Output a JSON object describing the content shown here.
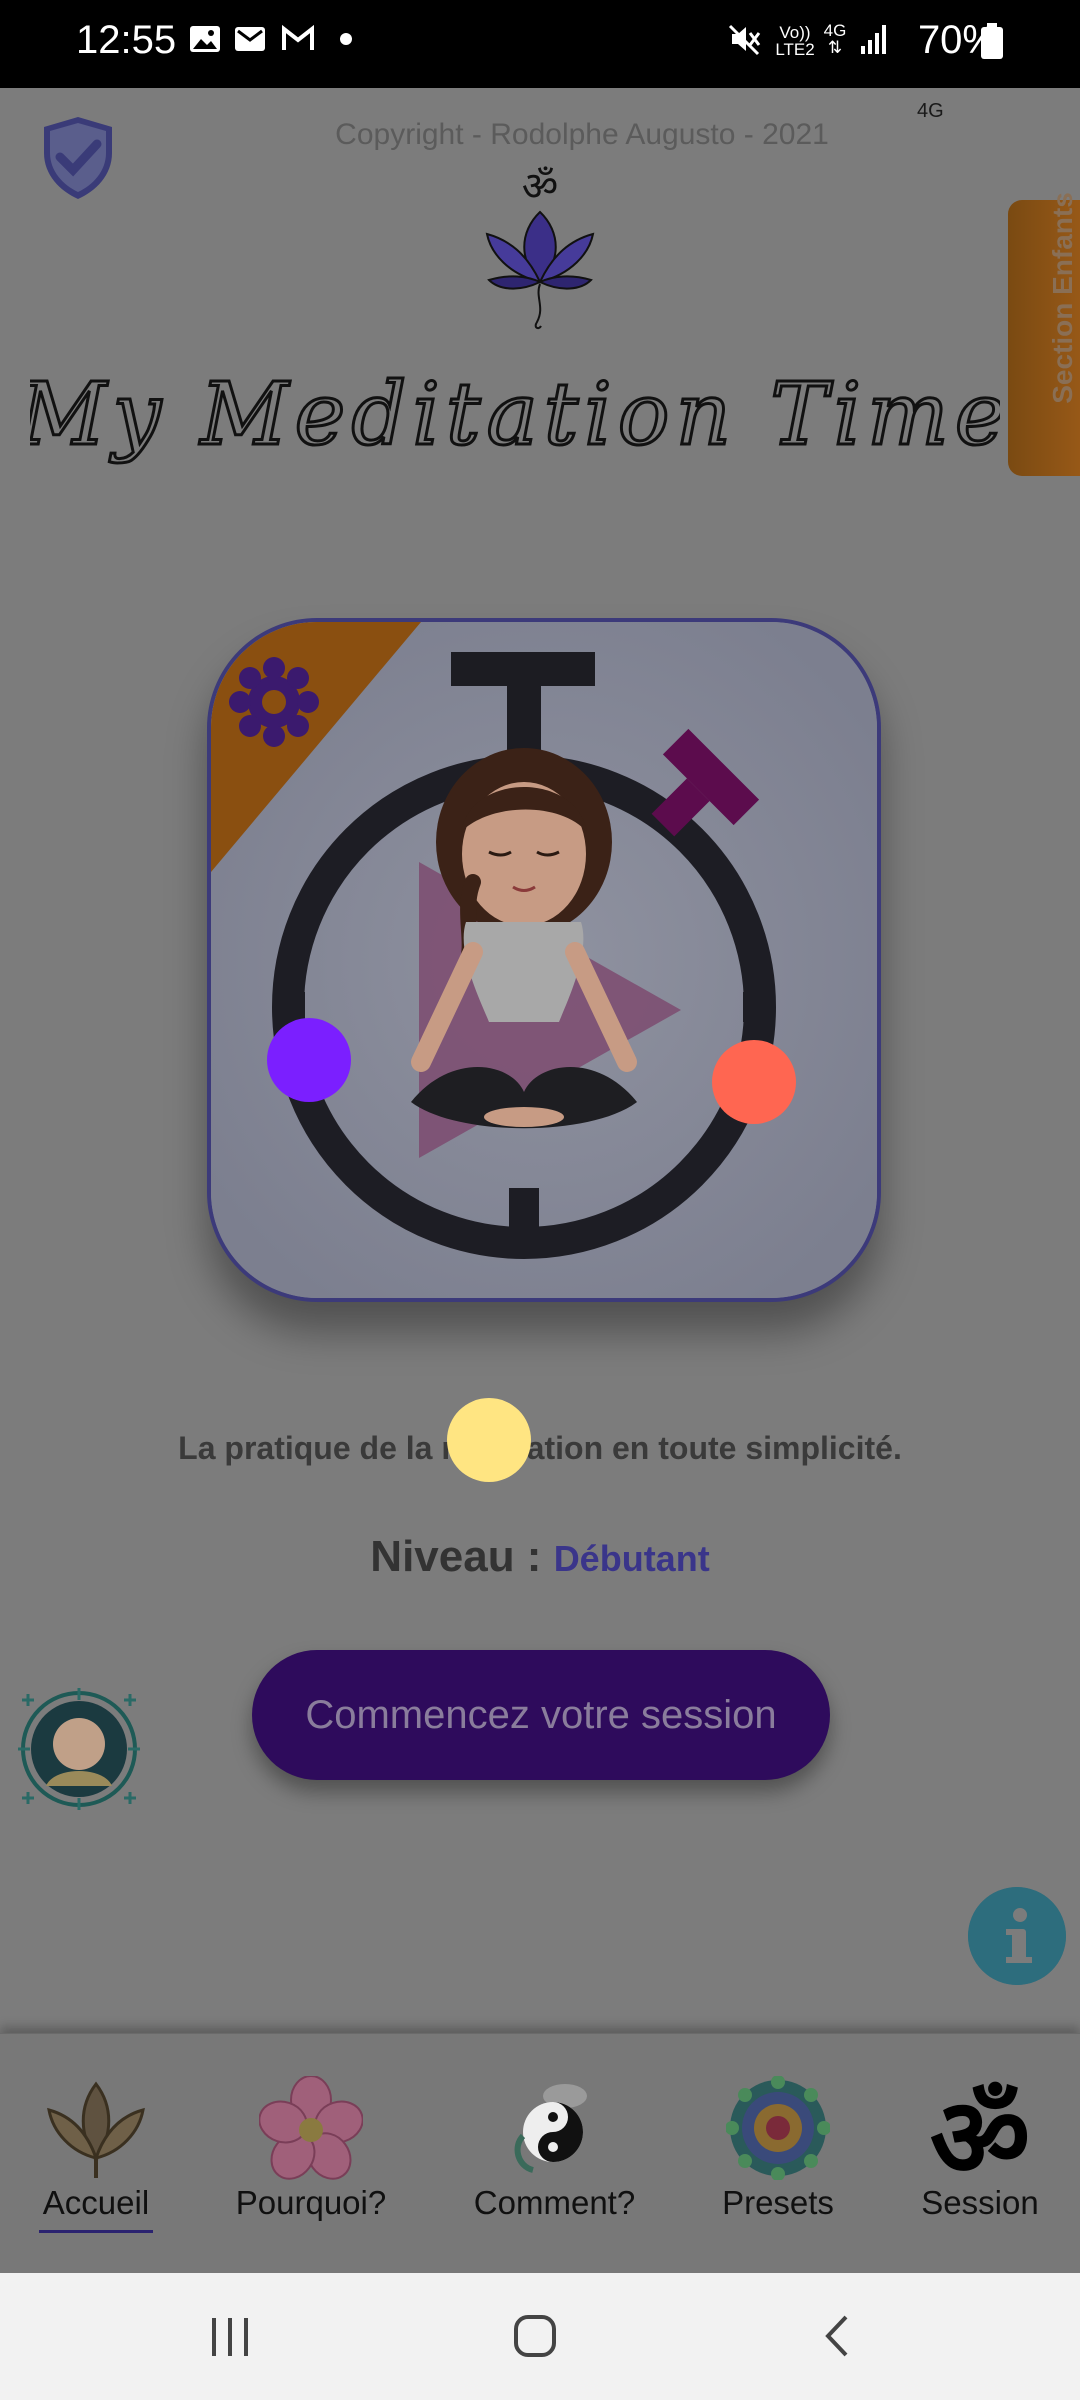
{
  "status_bar": {
    "time": "12:55",
    "battery_percent": "70%",
    "volte_label": "Vo))",
    "lte_label": "LTE2",
    "net_label": "4G",
    "icons": [
      "gallery-icon",
      "email-icon",
      "gmail-icon",
      "dot-icon",
      "mute-icon",
      "signal-icon",
      "battery-icon"
    ]
  },
  "header": {
    "copyright": "Copyright - Rodolphe Augusto - 2021",
    "network_tag": "4G",
    "app_title": "My Meditation Time"
  },
  "side_tab": {
    "label": "Section Enfants"
  },
  "main": {
    "tagline": "La pratique de la méditation en toute simplicité.",
    "level_label": "Niveau : ",
    "level_value": "Débutant",
    "start_button": "Commencez votre session"
  },
  "bottom_nav": {
    "items": [
      {
        "label": "Accueil",
        "icon": "lotus-icon",
        "active": true
      },
      {
        "label": "Pourquoi?",
        "icon": "flower-icon",
        "active": false
      },
      {
        "label": "Comment?",
        "icon": "yin-yang-icon",
        "active": false
      },
      {
        "label": "Presets",
        "icon": "mandala-icon",
        "active": false
      },
      {
        "label": "Session",
        "icon": "om-icon",
        "active": false
      }
    ]
  },
  "colors": {
    "accent": "#3a358a",
    "button": "#2e0b5c",
    "side_tab": "#8a5216",
    "info": "#2d6d7d",
    "dot_purple": "#7b1fff",
    "dot_coral": "#ff6651",
    "dot_yellow": "#ffe582"
  }
}
